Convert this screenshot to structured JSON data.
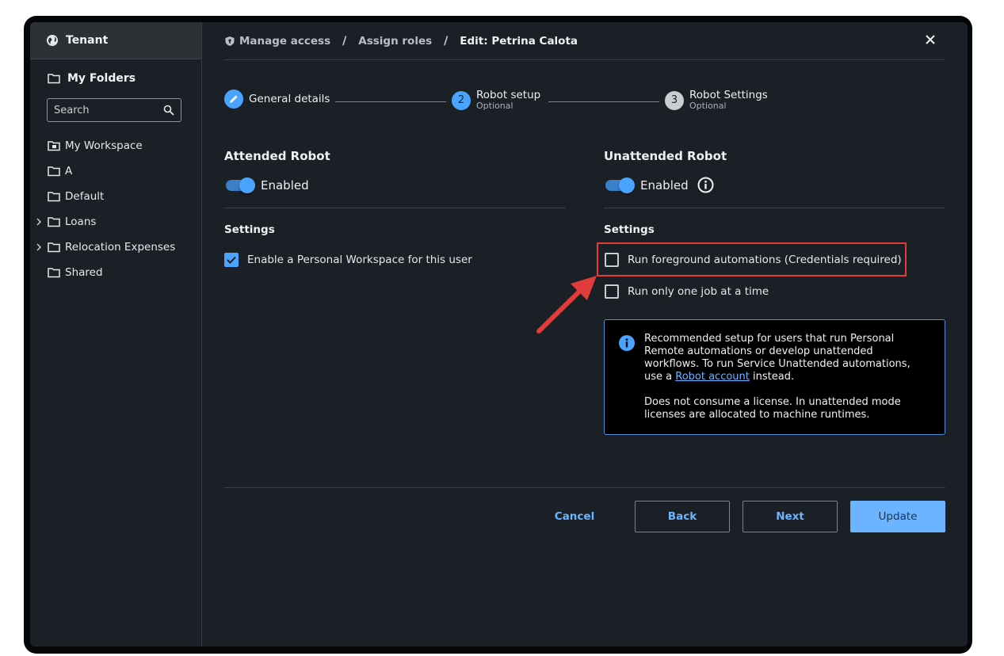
{
  "sidebar": {
    "tenant_label": "Tenant",
    "my_folders_label": "My Folders",
    "search_placeholder": "Search",
    "items": [
      {
        "label": "My Workspace",
        "icon": "workspace-folder-icon",
        "expandable": false
      },
      {
        "label": "A",
        "icon": "folder-icon",
        "expandable": false
      },
      {
        "label": "Default",
        "icon": "folder-icon",
        "expandable": false
      },
      {
        "label": "Loans",
        "icon": "folder-icon",
        "expandable": true
      },
      {
        "label": "Relocation Expenses",
        "icon": "folder-icon",
        "expandable": true
      },
      {
        "label": "Shared",
        "icon": "folder-icon",
        "expandable": false
      }
    ]
  },
  "breadcrumb": {
    "items": [
      "Manage access",
      "Assign roles"
    ],
    "separator": "/",
    "current": "Edit: Petrina Calota"
  },
  "stepper": {
    "steps": [
      {
        "label": "General details",
        "sublabel": "",
        "marker": "pencil-icon",
        "state": "done"
      },
      {
        "label": "Robot setup",
        "sublabel": "Optional",
        "marker": "2",
        "state": "active"
      },
      {
        "label": "Robot Settings",
        "sublabel": "Optional",
        "marker": "3",
        "state": "pending"
      }
    ]
  },
  "attended": {
    "title": "Attended Robot",
    "toggle_label": "Enabled",
    "enabled": true,
    "settings_title": "Settings",
    "options": [
      {
        "label": "Enable a Personal Workspace for this user",
        "checked": true
      }
    ]
  },
  "unattended": {
    "title": "Unattended Robot",
    "toggle_label": "Enabled",
    "enabled": true,
    "settings_title": "Settings",
    "options": [
      {
        "label": "Run foreground automations (Credentials required)",
        "checked": false
      },
      {
        "label": "Run only one job at a time",
        "checked": false
      }
    ],
    "notice": {
      "line_before_link": "Recommended setup for users that run Personal Remote automations or develop unattended workflows. To run Service Unattended automations, use a",
      "link": "Robot account",
      "line_after_link": "instead.",
      "paragraph2": "Does not consume a license. In unattended mode licenses are allocated to machine runtimes."
    }
  },
  "footer": {
    "cancel": "Cancel",
    "back": "Back",
    "next": "Next",
    "update": "Update"
  },
  "colors": {
    "accent": "#4aa3ff",
    "highlight": "#e23b3b",
    "background": "#1b2026"
  }
}
